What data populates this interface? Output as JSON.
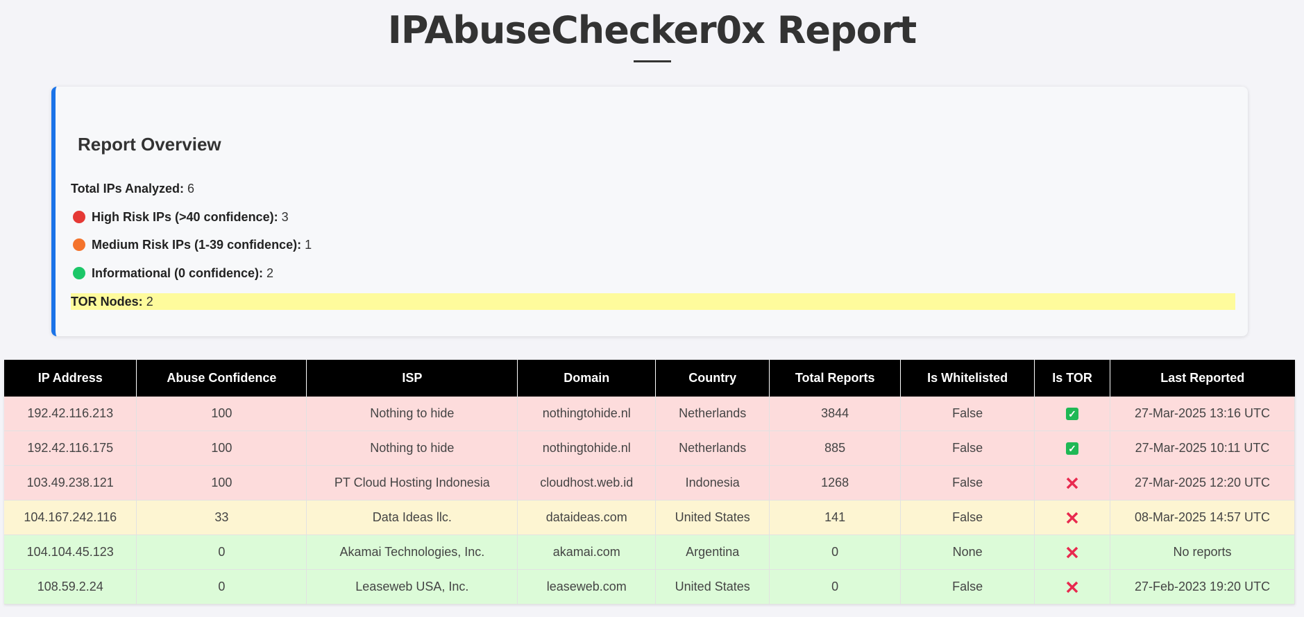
{
  "header": {
    "title": "IPAbuseChecker0x Report"
  },
  "overview": {
    "heading": "Report Overview",
    "total_label": "Total IPs Analyzed:",
    "total_value": "6",
    "high_label": "High Risk IPs (>40 confidence):",
    "high_value": "3",
    "medium_label": "Medium Risk IPs (1-39 confidence):",
    "medium_value": "1",
    "info_label": "Informational (0 confidence):",
    "info_value": "2",
    "tor_label": "TOR Nodes:",
    "tor_value": "2"
  },
  "colors": {
    "accent": "#1a73e8",
    "high": "#e53935",
    "medium": "#f4732c",
    "info": "#1cc768",
    "tor_highlight": "#fefb9c",
    "row_high": "#fddcdc",
    "row_medium": "#fdf5d2",
    "row_info": "#dcfbd8"
  },
  "table": {
    "headers": [
      "IP Address",
      "Abuse Confidence",
      "ISP",
      "Domain",
      "Country",
      "Total Reports",
      "Is Whitelisted",
      "Is TOR",
      "Last Reported"
    ],
    "rows": [
      {
        "risk": "high",
        "ip": "192.42.116.213",
        "confidence": "100",
        "isp": "Nothing to hide",
        "domain": "nothingtohide.nl",
        "country": "Netherlands",
        "reports": "3844",
        "whitelisted": "False",
        "tor": "check-icon",
        "last": "27-Mar-2025 13:16 UTC"
      },
      {
        "risk": "high",
        "ip": "192.42.116.175",
        "confidence": "100",
        "isp": "Nothing to hide",
        "domain": "nothingtohide.nl",
        "country": "Netherlands",
        "reports": "885",
        "whitelisted": "False",
        "tor": "check-icon",
        "last": "27-Mar-2025 10:11 UTC"
      },
      {
        "risk": "high",
        "ip": "103.49.238.121",
        "confidence": "100",
        "isp": "PT Cloud Hosting Indonesia",
        "domain": "cloudhost.web.id",
        "country": "Indonesia",
        "reports": "1268",
        "whitelisted": "False",
        "tor": "cross-icon",
        "last": "27-Mar-2025 12:20 UTC"
      },
      {
        "risk": "medium",
        "ip": "104.167.242.116",
        "confidence": "33",
        "isp": "Data Ideas llc.",
        "domain": "dataideas.com",
        "country": "United States",
        "reports": "141",
        "whitelisted": "False",
        "tor": "cross-icon",
        "last": "08-Mar-2025 14:57 UTC"
      },
      {
        "risk": "info",
        "ip": "104.104.45.123",
        "confidence": "0",
        "isp": "Akamai Technologies, Inc.",
        "domain": "akamai.com",
        "country": "Argentina",
        "reports": "0",
        "whitelisted": "None",
        "tor": "cross-icon",
        "last": "No reports"
      },
      {
        "risk": "info",
        "ip": "108.59.2.24",
        "confidence": "0",
        "isp": "Leaseweb USA, Inc.",
        "domain": "leaseweb.com",
        "country": "United States",
        "reports": "0",
        "whitelisted": "False",
        "tor": "cross-icon",
        "last": "27-Feb-2023 19:20 UTC"
      }
    ]
  }
}
